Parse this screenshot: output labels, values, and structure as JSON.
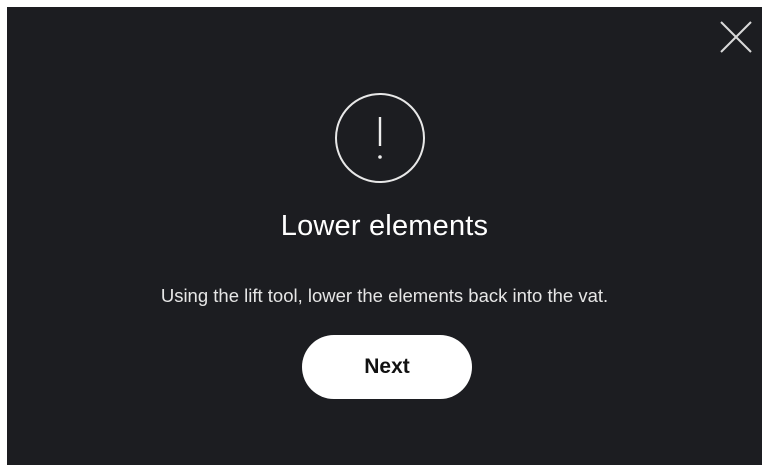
{
  "dialog": {
    "icon": "exclamation-icon",
    "title": "Lower elements",
    "message": "Using the lift tool, lower the elements back into the vat.",
    "next_label": "Next",
    "close_icon": "close-icon"
  },
  "colors": {
    "background": "#1c1d21",
    "button_bg": "#ffffff",
    "text": "#ffffff"
  }
}
